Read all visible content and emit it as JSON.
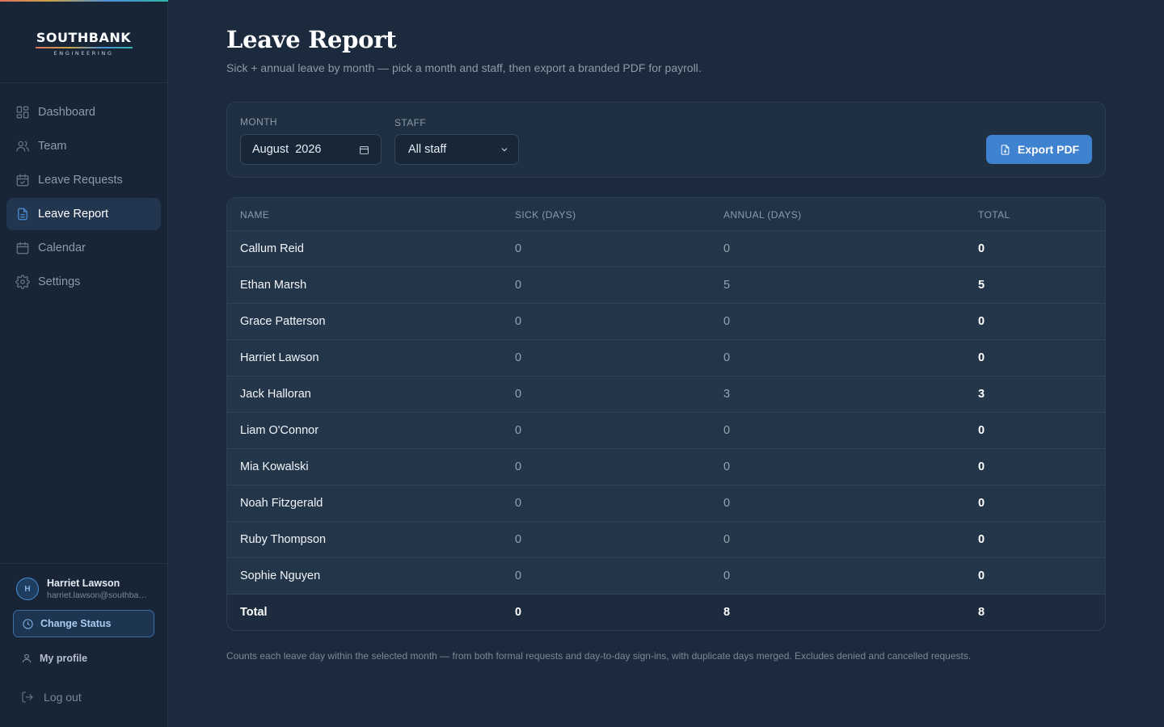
{
  "brand": {
    "name": "SOUTHBANK",
    "sub": "ENGINEERING"
  },
  "nav": {
    "items": [
      {
        "label": "Dashboard",
        "icon": "dashboard-icon"
      },
      {
        "label": "Team",
        "icon": "team-icon"
      },
      {
        "label": "Leave Requests",
        "icon": "calendar-check-icon"
      },
      {
        "label": "Leave Report",
        "icon": "document-icon",
        "active": true
      },
      {
        "label": "Calendar",
        "icon": "calendar-icon"
      },
      {
        "label": "Settings",
        "icon": "gear-icon"
      }
    ]
  },
  "user": {
    "initial": "H",
    "name": "Harriet Lawson",
    "email": "harriet.lawson@southbank.engineering"
  },
  "sidebar_actions": {
    "change_status": "Change Status",
    "my_profile": "My profile",
    "log_out": "Log out"
  },
  "page": {
    "title": "Leave Report",
    "subtitle": "Sick + annual leave by month — pick a month and staff, then export a branded PDF for payroll."
  },
  "filters": {
    "month_label": "MONTH",
    "month_value": "August  2026",
    "staff_label": "STAFF",
    "staff_value": "All staff",
    "export_label": "Export PDF"
  },
  "table": {
    "headers": {
      "name": "NAME",
      "sick": "SICK (DAYS)",
      "annual": "ANNUAL (DAYS)",
      "total": "TOTAL"
    },
    "rows": [
      {
        "name": "Callum Reid",
        "sick": "0",
        "annual": "0",
        "total": "0"
      },
      {
        "name": "Ethan Marsh",
        "sick": "0",
        "annual": "5",
        "total": "5"
      },
      {
        "name": "Grace Patterson",
        "sick": "0",
        "annual": "0",
        "total": "0"
      },
      {
        "name": "Harriet Lawson",
        "sick": "0",
        "annual": "0",
        "total": "0"
      },
      {
        "name": "Jack Halloran",
        "sick": "0",
        "annual": "3",
        "total": "3"
      },
      {
        "name": "Liam O'Connor",
        "sick": "0",
        "annual": "0",
        "total": "0"
      },
      {
        "name": "Mia Kowalski",
        "sick": "0",
        "annual": "0",
        "total": "0"
      },
      {
        "name": "Noah Fitzgerald",
        "sick": "0",
        "annual": "0",
        "total": "0"
      },
      {
        "name": "Ruby Thompson",
        "sick": "0",
        "annual": "0",
        "total": "0"
      },
      {
        "name": "Sophie Nguyen",
        "sick": "0",
        "annual": "0",
        "total": "0"
      }
    ],
    "totals": {
      "label": "Total",
      "sick": "0",
      "annual": "8",
      "total": "8"
    }
  },
  "footnote": "Counts each leave day within the selected month — from both formal requests and day-to-day sign-ins, with duplicate days merged. Excludes denied and cancelled requests.",
  "colors": {
    "background": "#1b2a3c",
    "sidebar": "#172536",
    "accent": "#3f82cf"
  }
}
